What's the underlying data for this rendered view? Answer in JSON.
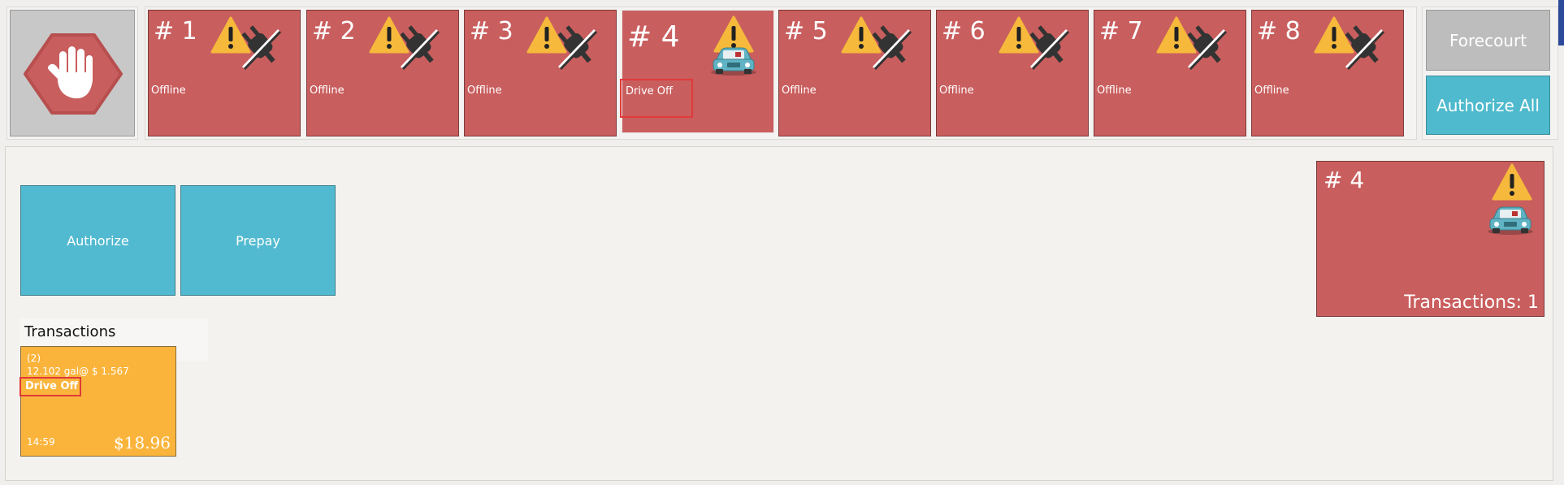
{
  "pumps": [
    {
      "number": "# 1",
      "status": "Offline",
      "icon": "offline-warning-icon"
    },
    {
      "number": "# 2",
      "status": "Offline",
      "icon": "offline-warning-icon"
    },
    {
      "number": "# 3",
      "status": "Offline",
      "icon": "offline-warning-icon"
    },
    {
      "number": "# 4",
      "status": "Drive Off",
      "icon": "car-warning-icon"
    },
    {
      "number": "# 5",
      "status": "Offline",
      "icon": "offline-warning-icon"
    },
    {
      "number": "# 6",
      "status": "Offline",
      "icon": "offline-warning-icon"
    },
    {
      "number": "# 7",
      "status": "Offline",
      "icon": "offline-warning-icon"
    },
    {
      "number": "# 8",
      "status": "Offline",
      "icon": "offline-warning-icon"
    }
  ],
  "colors": {
    "pump_red": "#c95e5e",
    "accent_teal": "#52bad0",
    "transaction_orange": "#fbb43b",
    "warning_yellow": "#f6b93b",
    "highlight_red": "#e03a3a"
  },
  "controls": {
    "forecourt_label": "Forecourt",
    "authorize_all_label": "Authorize All",
    "emergency_stop_icon": "stop-hand-icon"
  },
  "actions": {
    "authorize_label": "Authorize",
    "prepay_label": "Prepay"
  },
  "transactions": {
    "title": "Transactions",
    "items": [
      {
        "id": "(2)",
        "volume": "12.102 gal@ $ 1.567",
        "status": "Drive Off",
        "time": "14:59",
        "amount": "$18.96"
      }
    ]
  },
  "selected_pump": {
    "number": "# 4",
    "transactions_text": "Transactions: 1"
  }
}
